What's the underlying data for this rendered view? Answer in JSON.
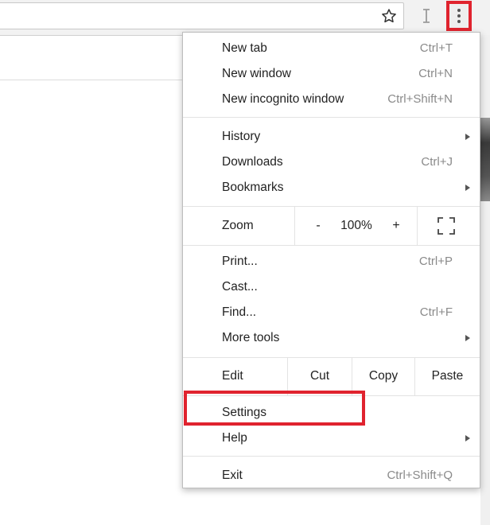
{
  "toolbar": {
    "bookmark_icon": "star-icon",
    "extension_icon": "text-cursor-icon",
    "menu_icon": "three-dots-vertical-icon"
  },
  "menu": {
    "new_tab": {
      "label": "New tab",
      "shortcut": "Ctrl+T"
    },
    "new_window": {
      "label": "New window",
      "shortcut": "Ctrl+N"
    },
    "new_incognito": {
      "label": "New incognito window",
      "shortcut": "Ctrl+Shift+N"
    },
    "history": {
      "label": "History"
    },
    "downloads": {
      "label": "Downloads",
      "shortcut": "Ctrl+J"
    },
    "bookmarks": {
      "label": "Bookmarks"
    },
    "zoom": {
      "label": "Zoom",
      "minus": "-",
      "level": "100%",
      "plus": "+"
    },
    "print": {
      "label": "Print...",
      "shortcut": "Ctrl+P"
    },
    "cast": {
      "label": "Cast..."
    },
    "find": {
      "label": "Find...",
      "shortcut": "Ctrl+F"
    },
    "more_tools": {
      "label": "More tools"
    },
    "edit": {
      "label": "Edit",
      "cut": "Cut",
      "copy": "Copy",
      "paste": "Paste"
    },
    "settings": {
      "label": "Settings"
    },
    "help": {
      "label": "Help"
    },
    "exit": {
      "label": "Exit",
      "shortcut": "Ctrl+Shift+Q"
    }
  },
  "colors": {
    "highlight": "#e0232e",
    "shortcut_text": "#8a8a8a"
  }
}
